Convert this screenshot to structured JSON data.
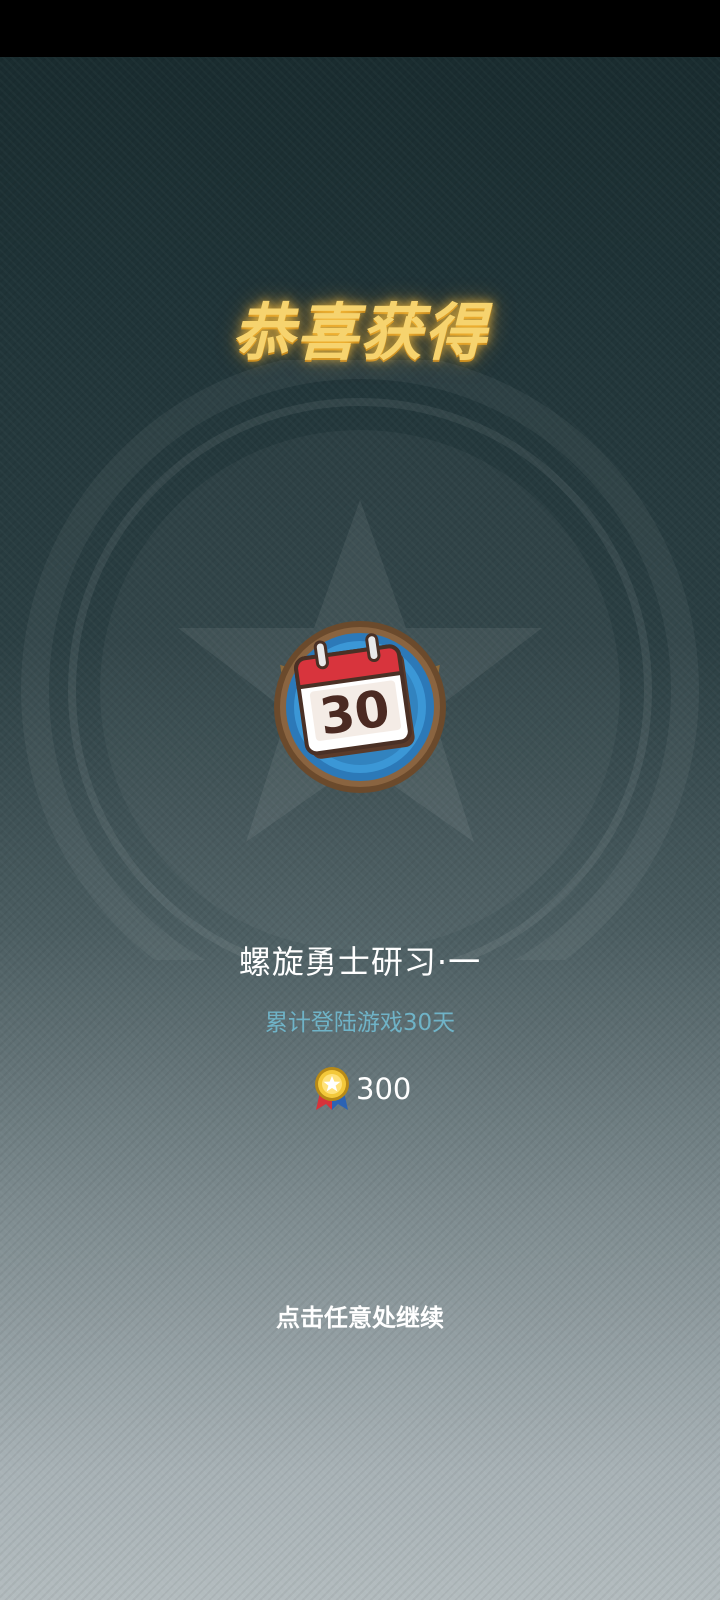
{
  "popup": {
    "title": "恭喜获得",
    "achievement": {
      "name": "螺旋勇士研习·一",
      "description": "累计登陆游戏30天",
      "badge_number": "30",
      "badge_icon": "calendar-icon"
    },
    "reward": {
      "icon": "gold-medal-icon",
      "amount": "300"
    },
    "continue_hint": "点击任意处继续"
  },
  "colors": {
    "title_gold": "#f6d36e",
    "description_teal": "#6fb3c7",
    "calendar_red": "#d8343d",
    "badge_blue": "#2c79b8"
  }
}
